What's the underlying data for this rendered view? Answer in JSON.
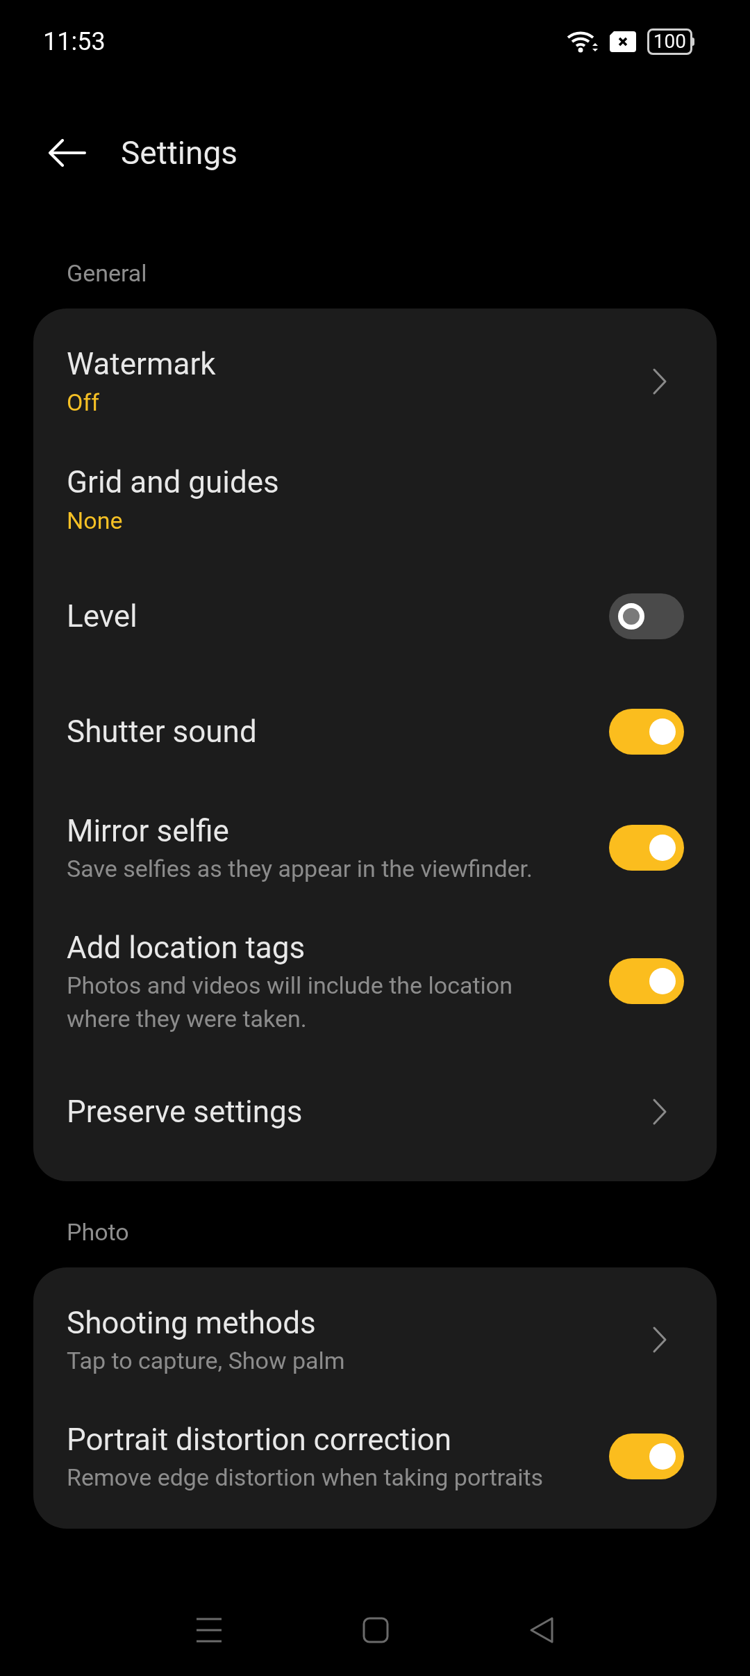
{
  "status_bar": {
    "time": "11:53",
    "battery": "100"
  },
  "header": {
    "title": "Settings"
  },
  "sections": [
    {
      "title": "General",
      "items": [
        {
          "kind": "link",
          "title": "Watermark",
          "value": "Off"
        },
        {
          "kind": "option",
          "title": "Grid and guides",
          "value": "None"
        },
        {
          "kind": "toggle",
          "title": "Level",
          "on": false
        },
        {
          "kind": "toggle",
          "title": "Shutter sound",
          "on": true
        },
        {
          "kind": "toggle",
          "title": "Mirror selfie",
          "description": "Save selfies as they appear in the viewfinder.",
          "on": true
        },
        {
          "kind": "toggle",
          "title": "Add location tags",
          "description": "Photos and videos will include the location where they were taken.",
          "on": true
        },
        {
          "kind": "link",
          "title": "Preserve settings"
        }
      ]
    },
    {
      "title": "Photo",
      "items": [
        {
          "kind": "link",
          "title": "Shooting methods",
          "description": "Tap to capture, Show palm"
        },
        {
          "kind": "toggle",
          "title": "Portrait distortion correction",
          "description": "Remove edge distortion when taking portraits",
          "on": true
        }
      ]
    }
  ]
}
